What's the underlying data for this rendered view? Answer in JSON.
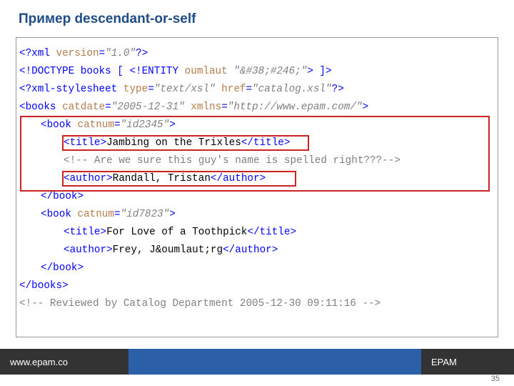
{
  "slide": {
    "title": "Пример descendant-or-self",
    "page_number": "35"
  },
  "code": {
    "xml_decl_open": "<?xml ",
    "xml_decl_attr": "version",
    "xml_decl_val": "\"1.0\"",
    "xml_decl_close": "?>",
    "doctype_open": "<!DOCTYPE books [ ",
    "doctype_entity": "<!ENTITY ",
    "doctype_entname": "oumlaut ",
    "doctype_entval": "\"&#38;#246;\"",
    "doctype_close": "> ]>",
    "xsl_open": "<?xml-stylesheet ",
    "xsl_a1n": "type",
    "xsl_a1v": "\"text/xsl\"",
    "xsl_a2n": "href",
    "xsl_a2v": "\"catalog.xsl\"",
    "xsl_close": "?>",
    "books_open": "<books ",
    "books_a1n": "catdate",
    "books_a1v": "\"2005-12-31\"",
    "books_a2n": "xmlns",
    "books_a2v": "\"http://www.epam.com/\"",
    "tag_close": ">",
    "book_open": "<book ",
    "book_attr": "catnum",
    "book1_val": "\"id2345\"",
    "book2_val": "\"id7823\"",
    "title_open": "<title>",
    "title_close": "</title>",
    "author_open": "<author>",
    "author_close": "</author>",
    "book_close": "</book>",
    "books_close": "</books>",
    "b1_title": "Jambing on the Trixles",
    "b1_comment": "<!-- Are we sure this guy's name is spelled right???-->",
    "b1_author": "Randall, Tristan",
    "b2_title": "For Love of a Toothpick",
    "b2_author_pre": "Frey, J",
    "b2_author_ent": "&oumlaut;",
    "b2_author_post": "rg",
    "end_comment": "<!-- Reviewed by Catalog Department 2005-12-30 09:11:16 -->"
  },
  "footer": {
    "left": "www.epam.co",
    "right": "EPAM"
  }
}
